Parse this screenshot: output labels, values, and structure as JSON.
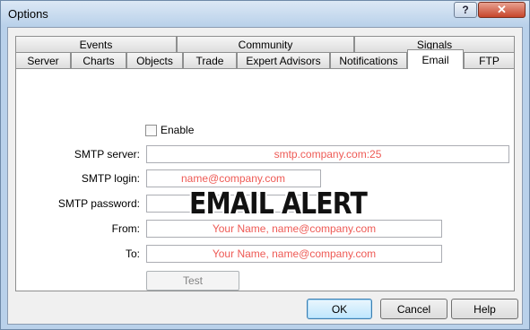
{
  "window": {
    "title": "Options",
    "help_glyph": "?",
    "close_glyph": "✕"
  },
  "tabs_row1": [
    "Events",
    "Community",
    "Signals"
  ],
  "tabs_row2": [
    "Server",
    "Charts",
    "Objects",
    "Trade",
    "Expert Advisors",
    "Notifications",
    "Email",
    "FTP"
  ],
  "active_tab": "Email",
  "form": {
    "enable_label": "Enable",
    "enable_checked": false,
    "smtp_server_label": "SMTP server:",
    "smtp_server_value": "smtp.company.com:25",
    "smtp_login_label": "SMTP login:",
    "smtp_login_value": "name@company.com",
    "smtp_password_label": "SMTP password:",
    "smtp_password_value": "",
    "from_label": "From:",
    "from_value": "Your Name, name@company.com",
    "to_label": "To:",
    "to_value": "Your Name, name@company.com",
    "test_label": "Test"
  },
  "overlay_text": "EMAIL ALERT",
  "buttons": {
    "ok": "OK",
    "cancel": "Cancel",
    "help": "Help"
  },
  "colors": {
    "placeholder_text": "#ee5a55",
    "window_frame": "#b9d1ea",
    "close_button": "#c7452b"
  }
}
